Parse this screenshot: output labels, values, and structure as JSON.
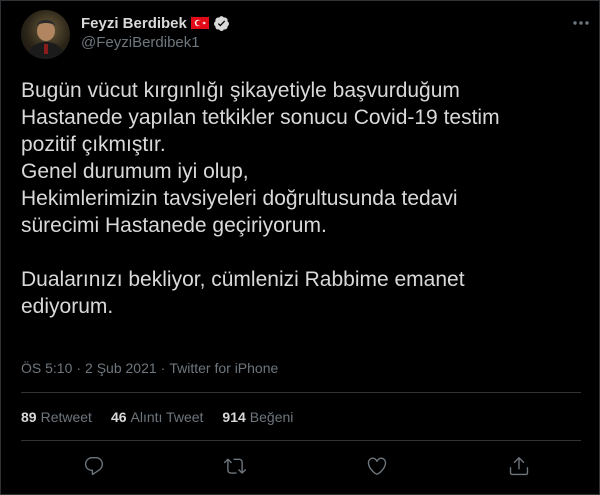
{
  "author": {
    "display_name": "Feyzi Berdibek",
    "handle": "@FeyziBerdibek1",
    "flag_icon": "turkey-flag-icon",
    "verified_icon": "verified-badge-icon"
  },
  "tweet": {
    "text": "Bugün vücut kırgınlığı şikayetiyle başvurduğum\nHastanede yapılan tetkikler sonucu Covid-19 testim\npozitif çıkmıştır.\nGenel durumum iyi olup,\nHekimlerimizin tavsiyeleri doğrultusunda tedavi\nsürecimi Hastanede geçiriyorum.\n\nDualarınızı bekliyor, cümlenizi Rabbime emanet\nediyorum.",
    "time": "ÖS 5:10",
    "date": "2 Şub 2021",
    "separator": "·",
    "source": "Twitter for iPhone"
  },
  "stats": {
    "retweets_count": "89",
    "retweets_label": "Retweet",
    "quotes_count": "46",
    "quotes_label": "Alıntı Tweet",
    "likes_count": "914",
    "likes_label": "Beğeni"
  },
  "actions": [
    "reply-icon",
    "retweet-icon",
    "like-icon",
    "share-icon"
  ],
  "colors": {
    "background": "#000000",
    "text": "#d9d9d9",
    "muted": "#6e767d",
    "divider": "#2f3336",
    "verified": "#d9d9d9",
    "flag": "#e30a17"
  }
}
